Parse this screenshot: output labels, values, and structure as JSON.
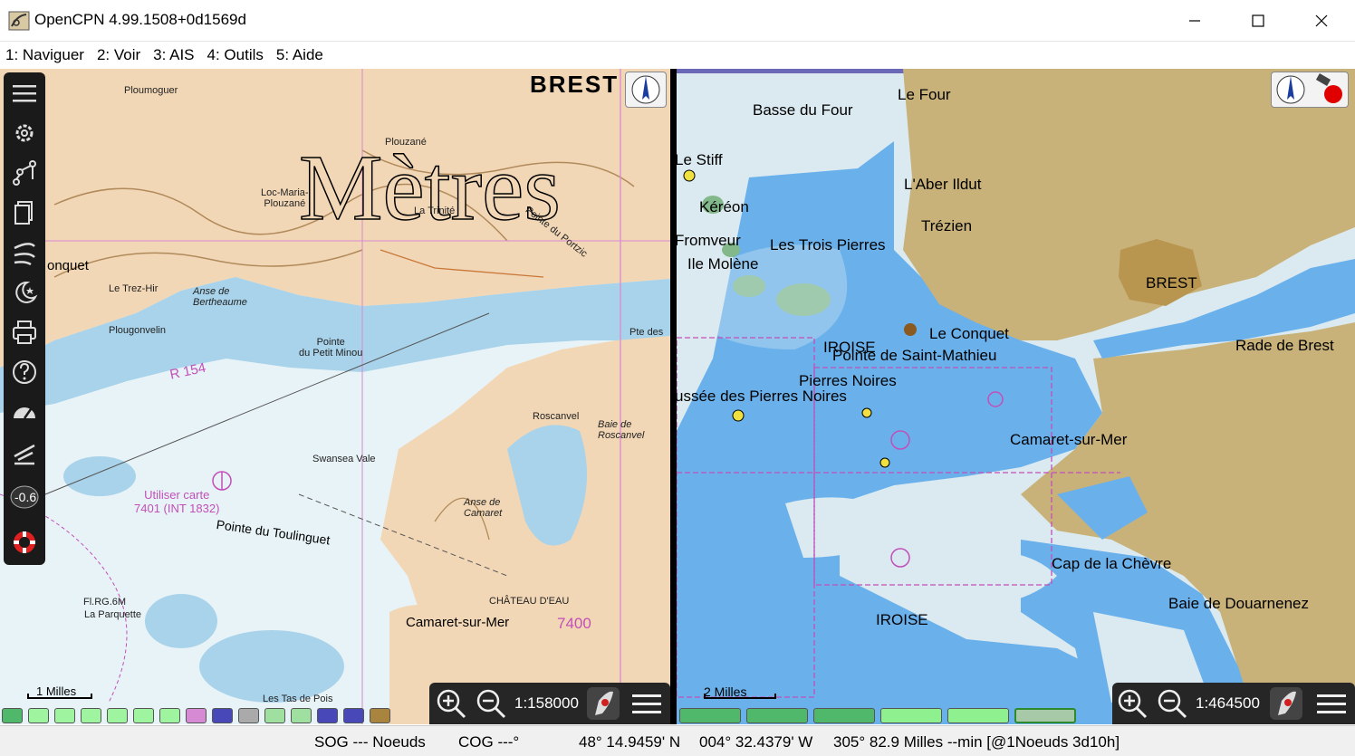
{
  "window": {
    "title": "OpenCPN 4.99.1508+0d1569d"
  },
  "menu": [
    "1: Naviguer",
    "2: Voir",
    "3: AIS",
    "4: Outils",
    "5: Aide"
  ],
  "left_chart": {
    "watermark": "Mètres",
    "scale": "1:158000",
    "scalebar": "1 Milles",
    "labels": {
      "brest": "BREST",
      "ploumoguer": "Ploumoguer",
      "plouzane": "Plouzané",
      "locmaria": "Loc-Maria-\nPlouzané",
      "la_trinite": "La Trinité",
      "pointe_portzic": "Pointe du Portzic",
      "conquet": "onquet",
      "trez_hir": "Le Trez-Hir",
      "plougonvelin": "Plougonvelin",
      "anse_bertheaume": "Anse de\nBertheaume",
      "petit_minou": "Pointe\ndu Petit Minou",
      "roscanvel": "Roscanvel",
      "baie_roscanvel": "Baie de\nRoscanvel",
      "utiliser_carte": "Utiliser carte\n7401 (INT 1832)",
      "pointe_toulinguet": "Pointe du Toulinguet",
      "chateau_deau": "CHÂTEAU D'EAU",
      "camaret": "Camaret-sur-Mer",
      "chart_no": "7400",
      "anse_camaret": "Anse de\nCamaret",
      "la_parquette": "La Parquette",
      "fl_rg": "Fl.RG.6M",
      "tas_de_pois": "Les Tas de Pois",
      "r154": "R 154",
      "pte_des": "Pte des",
      "swansea": "Swansea Vale"
    }
  },
  "right_chart": {
    "scale": "1:464500",
    "scalebar": "2 Milles",
    "labels": {
      "le_four": "Le Four",
      "basse_du_four": "Basse du Four",
      "le_stiff": "Le Stiff",
      "kereon": "Kéréon",
      "aber_ildut": "L'Aber Ildut",
      "trezien": "Trézien",
      "fromveur": "Fromveur",
      "trois_pierres": "Les Trois Pierres",
      "molene": "Ile Molène",
      "brest": "BREST",
      "le_conquet": "Le Conquet",
      "iroise1": "IROISE",
      "saint_mathieu": "Pointe de Saint-Mathieu",
      "rade_brest": "Rade de Brest",
      "pierres_noires": "Pierres Noires",
      "chaussee": "ussée des Pierres Noires",
      "camaret": "Camaret-sur-Mer",
      "cap_chevre": "Cap de la Chèvre",
      "baie_douarnenez": "Baie de Douarnenez",
      "iroise2": "IROISE"
    }
  },
  "status": {
    "sog": "SOG --- Noeuds",
    "cog": "COG ---°",
    "lat": "48° 14.9459' N",
    "lon": "004° 32.4379' W",
    "brg": "305°  82.9 Milles --min [@1Noeuds 3d10h]"
  },
  "colors": {
    "land": "#f2d7b6",
    "shallow": "#a8d3ea",
    "sea": "#e8f3f7",
    "enc_land": "#c8b27a",
    "enc_deep": "#6ab1ec",
    "enc_shallow": "#dbeaf0",
    "magenta": "#c24fb8"
  }
}
